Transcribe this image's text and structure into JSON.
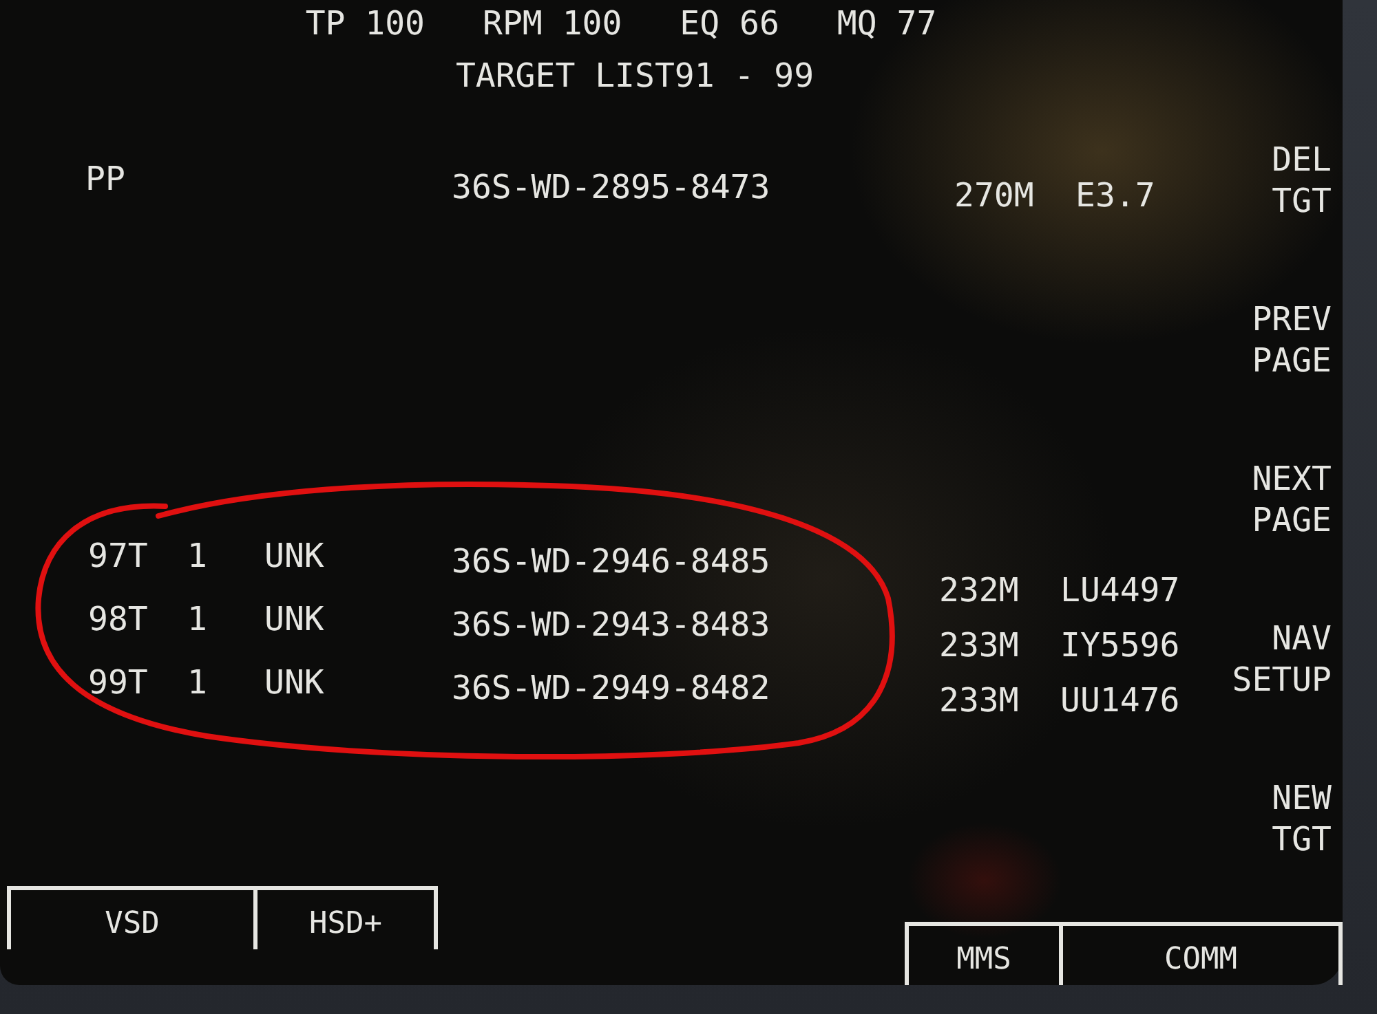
{
  "header": {
    "readouts": [
      "TP 100",
      "RPM 100",
      "EQ 66",
      "MQ 77"
    ],
    "title": "TARGET LIST91 - 99"
  },
  "present_position": {
    "label": "PP",
    "grid": "36S-WD-2895-8473",
    "range": "270M",
    "elevation": "E3.7"
  },
  "targets": [
    {
      "id": "97T",
      "column_2": "1",
      "type": "UNK",
      "grid": "36S-WD-2946-8485",
      "range": "232M",
      "code": "LU4497"
    },
    {
      "id": "98T",
      "column_2": "1",
      "type": "UNK",
      "grid": "36S-WD-2943-8483",
      "range": "233M",
      "code": "IY5596"
    },
    {
      "id": "99T",
      "column_2": "1",
      "type": "UNK",
      "grid": "36S-WD-2949-8482",
      "range": "233M",
      "code": "UU1476"
    }
  ],
  "side_options": [
    {
      "lines": [
        "DEL",
        "TGT"
      ]
    },
    {
      "lines": [
        "PREV",
        "PAGE"
      ]
    },
    {
      "lines": [
        "NEXT",
        "PAGE"
      ]
    },
    {
      "lines": [
        "NAV",
        "SETUP"
      ]
    },
    {
      "lines": [
        "NEW",
        "TGT"
      ]
    }
  ],
  "bottom_tabs_left": [
    "VSD",
    "HSD+"
  ],
  "bottom_tabs_right": [
    "MMS",
    "COMM"
  ]
}
